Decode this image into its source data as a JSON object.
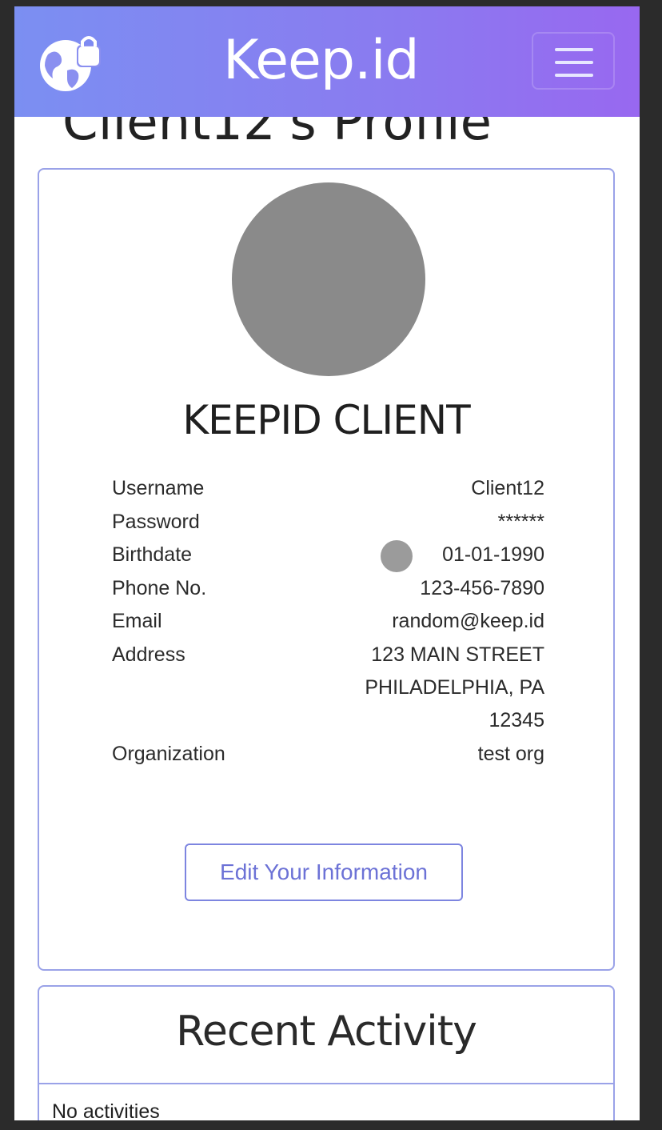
{
  "nav": {
    "brand": "Keep.id",
    "logo_icon": "globe-lock-icon",
    "menu_icon": "hamburger-menu-icon",
    "gradient_colors": [
      "#7b8ff2",
      "#9868f0"
    ]
  },
  "page": {
    "heading": "Client12's Profile"
  },
  "profile": {
    "avatar_icon": "avatar-placeholder",
    "name": "KEEPID CLIENT",
    "fields": {
      "username": {
        "label": "Username",
        "value": "Client12"
      },
      "password": {
        "label": "Password",
        "value": "******"
      },
      "birthdate": {
        "label": "Birthdate",
        "value": "01-01-1990"
      },
      "phone": {
        "label": "Phone No.",
        "value": "123-456-7890"
      },
      "email": {
        "label": "Email",
        "value": "random@keep.id"
      },
      "address": {
        "label": "Address",
        "line1": "123 MAIN STREET",
        "line2": "PHILADELPHIA, PA",
        "line3": "12345"
      },
      "organization": {
        "label": "Organization",
        "value": "test org"
      }
    },
    "edit_button": "Edit Your Information"
  },
  "activity": {
    "title": "Recent Activity",
    "empty_text": "No activities"
  },
  "colors": {
    "accent": "#7d85e0",
    "card_border": "#9aa2e8",
    "avatar": "#8a8a8a"
  }
}
